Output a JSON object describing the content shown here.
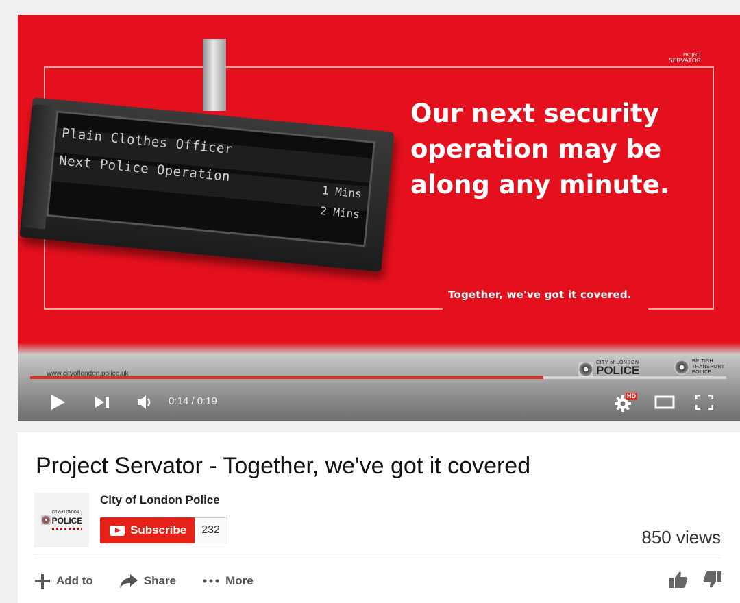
{
  "video_frame": {
    "board_lines": [
      {
        "text": "Plain Clothes Officer",
        "time": "1 Mins"
      },
      {
        "text": "Next Police Operation",
        "time": "2 Mins"
      }
    ],
    "headline_lines": [
      "Our next security",
      "operation may be",
      "along any minute."
    ],
    "tagline": "Together, we've got it covered.",
    "servator_logo_top": "PROJECT",
    "servator_logo_name": "SERVATOR",
    "site_url": "www.cityoflondon.police.uk",
    "partner_logos": [
      {
        "top": "CITY of LONDON",
        "name": "POLICE"
      },
      {
        "top": "BRITISH",
        "name": "TRANSPORT",
        "bottom": "POLICE"
      }
    ],
    "accent_color": "#e5101d"
  },
  "player": {
    "progress_fraction": 0.737,
    "current_time": "0:14",
    "duration": "0:19",
    "time_display": "0:14 / 0:19",
    "hd_badge": "HD",
    "icons": [
      "play-icon",
      "next-icon",
      "volume-icon",
      "settings-icon",
      "theater-mode-icon",
      "fullscreen-icon"
    ]
  },
  "video_info": {
    "title": "Project Servator - Together, we've got it covered",
    "channel_name": "City of London Police",
    "channel_logo": {
      "top": "CITY of LONDON",
      "name": "POLICE"
    },
    "subscribe_label": "Subscribe",
    "subscriber_count": "232",
    "views": "850 views"
  },
  "actions": [
    {
      "icon": "plus-icon",
      "label": "Add to"
    },
    {
      "icon": "share-icon",
      "label": "Share"
    },
    {
      "icon": "more-dots-icon",
      "label": "More"
    }
  ],
  "ratings": {
    "like_icon": "thumbs-up-icon",
    "dislike_icon": "thumbs-down-icon"
  }
}
